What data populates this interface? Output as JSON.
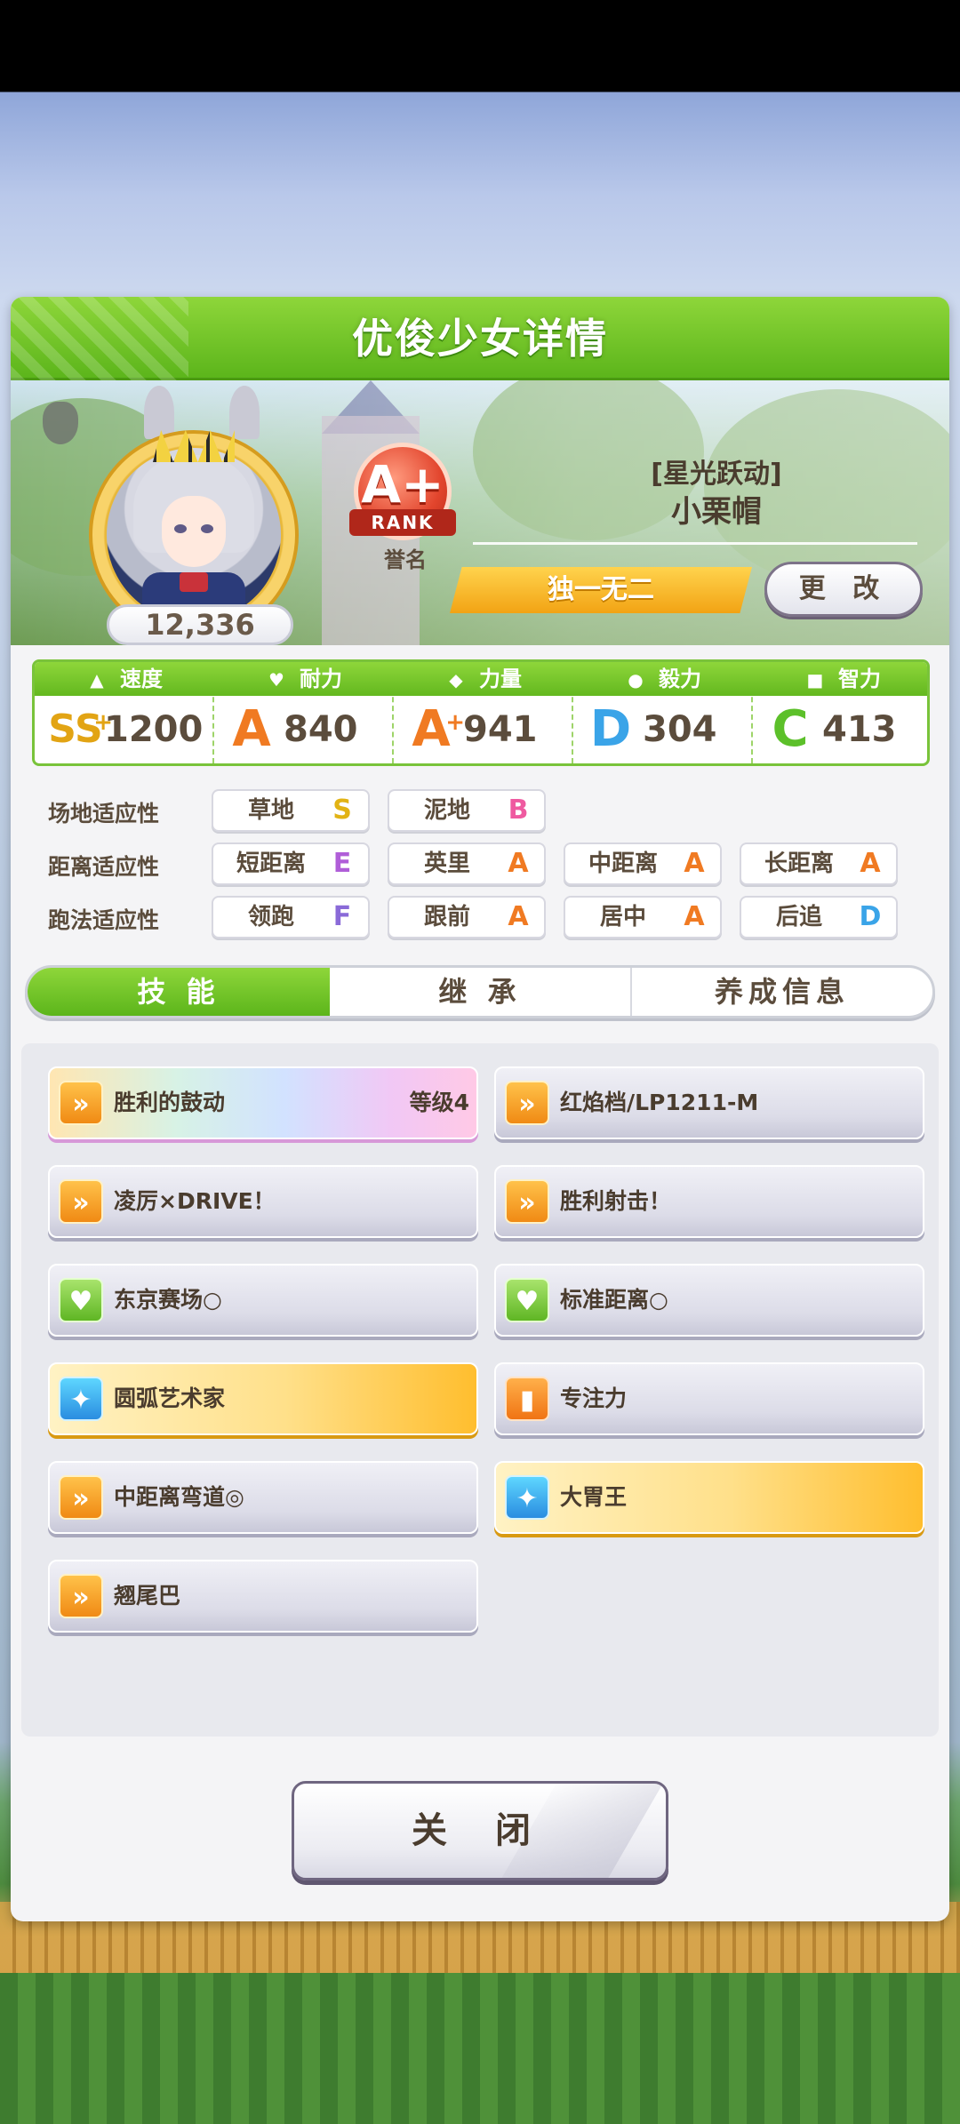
{
  "dialog": {
    "title": "优俊少女详情"
  },
  "profile": {
    "fans": "12,336",
    "rank": {
      "grade": "A+",
      "word": "RANK"
    },
    "honor_label": "誉名",
    "epithet": "[星光跃动]",
    "name": "小栗帽",
    "title": "独一无二",
    "change_button": "更 改"
  },
  "stats": [
    {
      "name": "速度",
      "icon": "shoe-icon",
      "grade": "SS",
      "plus": "+",
      "value": "1200",
      "color": "#e2a414"
    },
    {
      "name": "耐力",
      "icon": "heart-icon",
      "grade": "A",
      "plus": "",
      "value": "840",
      "color": "#f07a22"
    },
    {
      "name": "力量",
      "icon": "muscle-icon",
      "grade": "A",
      "plus": "+",
      "value": "941",
      "color": "#f07a22"
    },
    {
      "name": "毅力",
      "icon": "flame-icon",
      "grade": "D",
      "plus": "",
      "value": "304",
      "color": "#3aa4e8"
    },
    {
      "name": "智力",
      "icon": "cap-icon",
      "grade": "C",
      "plus": "",
      "value": "413",
      "color": "#5cc02a"
    }
  ],
  "aptitude": {
    "track": {
      "label": "场地适应性",
      "items": [
        {
          "name": "草地",
          "grade": "S"
        },
        {
          "name": "泥地",
          "grade": "B"
        }
      ]
    },
    "distance": {
      "label": "距离适应性",
      "items": [
        {
          "name": "短距离",
          "grade": "E"
        },
        {
          "name": "英里",
          "grade": "A"
        },
        {
          "name": "中距离",
          "grade": "A"
        },
        {
          "name": "长距离",
          "grade": "A"
        }
      ]
    },
    "style": {
      "label": "跑法适应性",
      "items": [
        {
          "name": "领跑",
          "grade": "F"
        },
        {
          "name": "跟前",
          "grade": "A"
        },
        {
          "name": "居中",
          "grade": "A"
        },
        {
          "name": "后追",
          "grade": "D"
        }
      ]
    }
  },
  "grade_colors": {
    "S": "#e2b314",
    "A": "#f07a22",
    "B": "#ef5aa0",
    "C": "#5cc02a",
    "D": "#3aa4e8",
    "E": "#b05ed8",
    "F": "#8a6ad8"
  },
  "tabs": [
    {
      "label": "技 能",
      "active": true
    },
    {
      "label": "继 承",
      "active": false
    },
    {
      "label": "养成信息",
      "active": false
    }
  ],
  "skills": [
    {
      "name": "胜利的鼓动",
      "level": "等级4",
      "icon": "running-icon",
      "style": "rainbow"
    },
    {
      "name": "红焰档/LP1211-M",
      "level": "",
      "icon": "running-icon",
      "style": "normal"
    },
    {
      "name": "凌厉×DRIVE！",
      "level": "",
      "icon": "running-icon",
      "style": "normal"
    },
    {
      "name": "胜利射击！",
      "level": "",
      "icon": "running-icon",
      "style": "normal"
    },
    {
      "name": "东京赛场○",
      "level": "",
      "icon": "heart-icon",
      "style": "normal"
    },
    {
      "name": "标准距离○",
      "level": "",
      "icon": "heart-icon",
      "style": "normal"
    },
    {
      "name": "圆弧艺术家",
      "level": "",
      "icon": "sparkle-icon",
      "style": "gold"
    },
    {
      "name": "专注力",
      "level": "",
      "icon": "focus-icon",
      "style": "normal"
    },
    {
      "name": "中距离弯道◎",
      "level": "",
      "icon": "running-icon",
      "style": "normal"
    },
    {
      "name": "大胃王",
      "level": "",
      "icon": "sparkle-icon",
      "style": "gold"
    },
    {
      "name": "翘尾巴",
      "level": "",
      "icon": "running-icon",
      "style": "normal"
    }
  ],
  "close_button": "关 闭"
}
